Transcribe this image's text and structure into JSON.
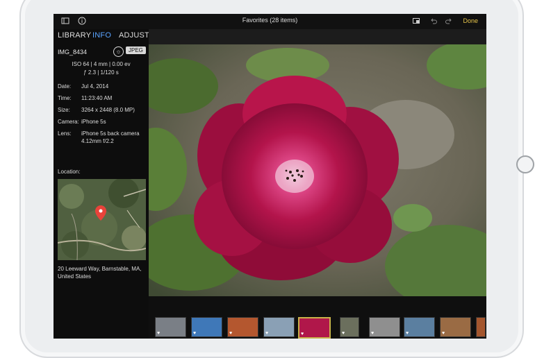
{
  "topbar": {
    "title": "Favorites (28 items)",
    "done_label": "Done",
    "icons": [
      "sidebar-icon",
      "info-icon",
      "crop-icon",
      "undo-icon",
      "redo-icon"
    ]
  },
  "sidebar": {
    "tabs": [
      "LIBRARY",
      "INFO",
      "ADJUST"
    ],
    "active_tab": "INFO",
    "filename": "IMG_8434",
    "format_badge": "JPEG",
    "exif_line1": "ISO 64 | 4 mm | 0.00 ev",
    "exif_line2": "ƒ 2.3 | 1/120 s",
    "details": [
      {
        "key": "Date:",
        "value": "Jul 4, 2014"
      },
      {
        "key": "Time:",
        "value": "11:23:40 AM"
      },
      {
        "key": "Size:",
        "value": "3264 x 2448 (8.0 MP)"
      },
      {
        "key": "Camera:",
        "value": "iPhone 5s"
      },
      {
        "key": "Lens:",
        "value": "iPhone 5s back camera"
      }
    ],
    "lens_line2": "4.12mm f/2.2",
    "location_label": "Location:",
    "address_line1": "20 Leeward Way, Barnstable, MA,",
    "address_line2": "United States"
  },
  "colors": {
    "accent_blue": "#5aa3ff",
    "done_yellow": "#e5c34a",
    "pin_red": "#e8433a",
    "flower": "#b0174a"
  },
  "filmstrip": {
    "selected_index": 4
  }
}
